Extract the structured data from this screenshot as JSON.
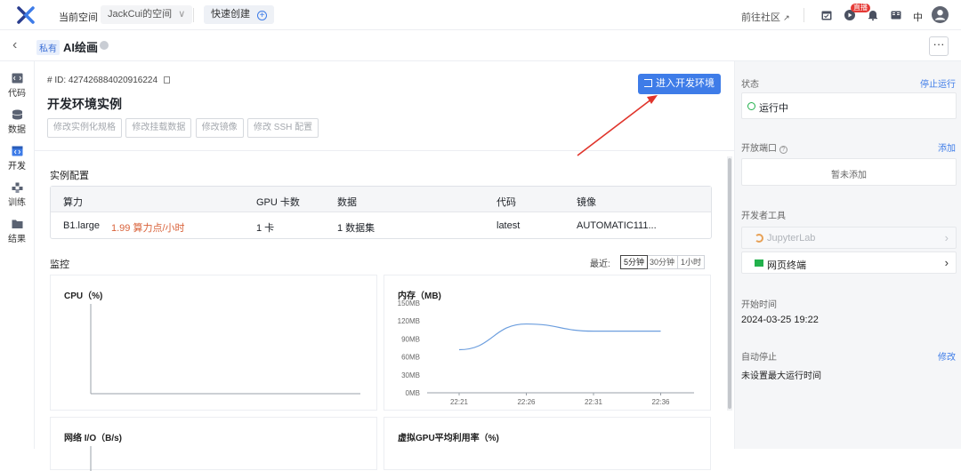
{
  "topbar": {
    "current_space_label": "当前空间",
    "space_name": "JackCui的空间",
    "quick_create": "快速创建",
    "community_link": "前往社区",
    "live_badge": "直播",
    "lang": "中"
  },
  "subbar": {
    "private_tag": "私有",
    "title": "AI绘画"
  },
  "nav": [
    {
      "label": "代码",
      "icon": "code-icon"
    },
    {
      "label": "数据",
      "icon": "database-icon"
    },
    {
      "label": "开发",
      "icon": "dev-icon"
    },
    {
      "label": "训练",
      "icon": "train-icon"
    },
    {
      "label": "结果",
      "icon": "folder-icon"
    }
  ],
  "main": {
    "id_line": "# ID: 427426884020916224",
    "title": "开发环境实例",
    "enter_button": "进入开发环境",
    "actions": [
      "修改实例化规格",
      "修改挂载数据",
      "修改镜像",
      "修改 SSH 配置"
    ],
    "config_label": "实例配置",
    "config_headers": [
      "算力",
      "GPU 卡数",
      "数据",
      "代码",
      "镜像"
    ],
    "config_row": {
      "compute": "B1.large",
      "cost": "1.99 算力点/小时",
      "gpu": "1 卡",
      "data": "1 数据集",
      "code": "latest",
      "image": "AUTOMATIC111..."
    },
    "monitor_label": "监控",
    "recent_label": "最近:",
    "ranges": [
      "5分钟",
      "30分钟",
      "1小时"
    ],
    "active_range": "5分钟",
    "charts": {
      "cpu_title": "CPU（%)",
      "mem_title": "内存（MB)",
      "net_title": "网络 I/O（B/s)",
      "gpu_title": "虚拟GPU平均利用率（%)"
    }
  },
  "chart_data": [
    {
      "type": "line",
      "title": "CPU（%)",
      "x": [],
      "series": []
    },
    {
      "type": "line",
      "title": "内存（MB)",
      "ylim": [
        0,
        150
      ],
      "yticks": [
        "0MB",
        "30MB",
        "60MB",
        "90MB",
        "120MB",
        "150MB"
      ],
      "x": [
        "22:21",
        "22:26",
        "22:31",
        "22:36"
      ],
      "series": [
        {
          "values": [
            72,
            115,
            103,
            103
          ]
        }
      ],
      "grid": false
    }
  ],
  "right": {
    "status_label": "状态",
    "stop_link": "停止运行",
    "status_value": "运行中",
    "ports_label": "开放端口",
    "add_link": "添加",
    "ports_empty": "暂未添加",
    "tools_label": "开发者工具",
    "tool_jupyter": "JupyterLab",
    "tool_terminal": "网页终端",
    "start_label": "开始时间",
    "start_value": "2024-03-25 19:22",
    "autostop_label": "自动停止",
    "modify_link": "修改",
    "autostop_value": "未设置最大运行时间"
  },
  "colors": {
    "accent": "#3e7ce8",
    "cost": "#d9623a",
    "running": "#22b14c",
    "arrow": "#e0342b"
  }
}
